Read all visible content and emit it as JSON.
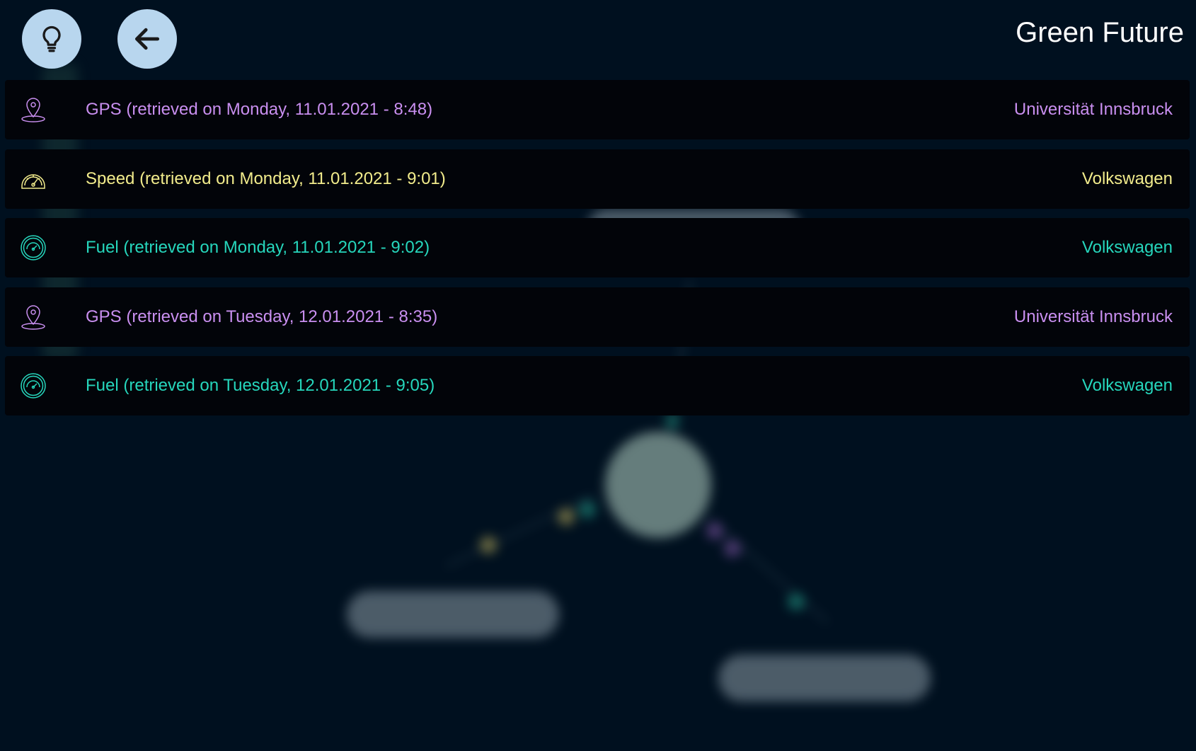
{
  "header": {
    "title": "Green Future",
    "hint_button_icon": "lightbulb-icon",
    "back_button_icon": "arrow-left-icon"
  },
  "colors": {
    "gps": "#c98ff0",
    "speed": "#f2ec8c",
    "fuel": "#26d6bc",
    "button_bg": "#b8d6ee",
    "background": "#00101f"
  },
  "records": [
    {
      "icon": "location-pin-icon",
      "type": "gps",
      "label": "GPS (retrieved on Monday, 11.01.2021 - 8:48)",
      "provider": "Universität Innsbruck"
    },
    {
      "icon": "speedometer-icon",
      "type": "speed",
      "label": "Speed (retrieved on Monday, 11.01.2021 - 9:01)",
      "provider": "Volkswagen"
    },
    {
      "icon": "fuel-gauge-icon",
      "type": "fuel",
      "label": "Fuel (retrieved on Monday, 11.01.2021 - 9:02)",
      "provider": "Volkswagen"
    },
    {
      "icon": "location-pin-icon",
      "type": "gps",
      "label": "GPS (retrieved on Tuesday, 12.01.2021 - 8:35)",
      "provider": "Universität Innsbruck"
    },
    {
      "icon": "fuel-gauge-icon",
      "type": "fuel",
      "label": "Fuel (retrieved on Tuesday, 12.01.2021 - 9:05)",
      "provider": "Volkswagen"
    }
  ]
}
